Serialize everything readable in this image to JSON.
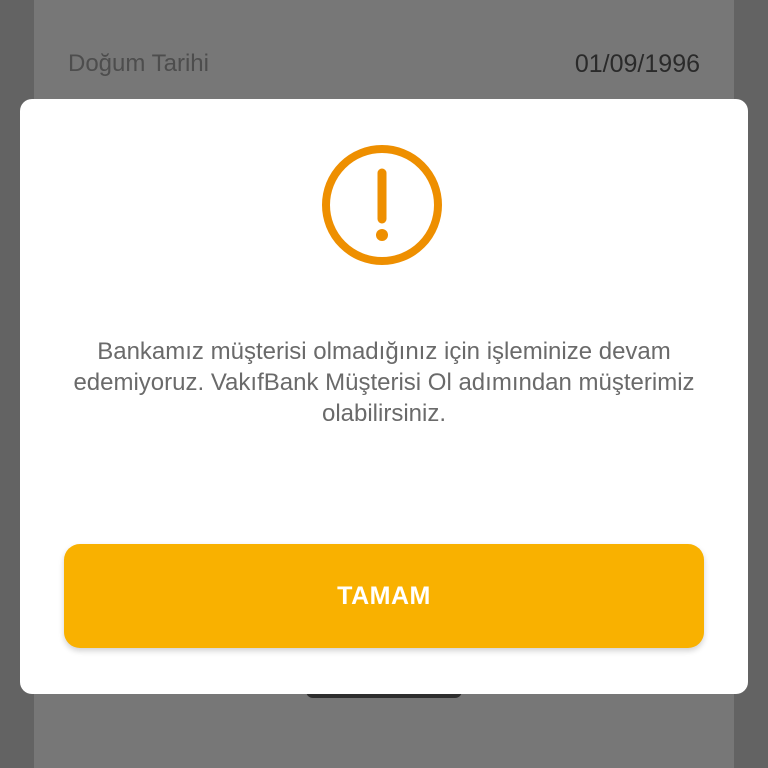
{
  "background": {
    "birth_date_label": "Doğum Tarihi",
    "birth_date_value": "01/09/1996"
  },
  "dialog": {
    "icon": "exclamation-circle-icon",
    "message": "Bankamız müşterisi olmadığınız için işleminize devam edemiyoruz. VakıfBank Müşterisi Ol adımından müşterimiz olabilirsiniz.",
    "ok_label": "TAMAM"
  },
  "colors": {
    "accent": "#F9B100",
    "icon": "#EE8F00",
    "overlay": "#636363"
  }
}
